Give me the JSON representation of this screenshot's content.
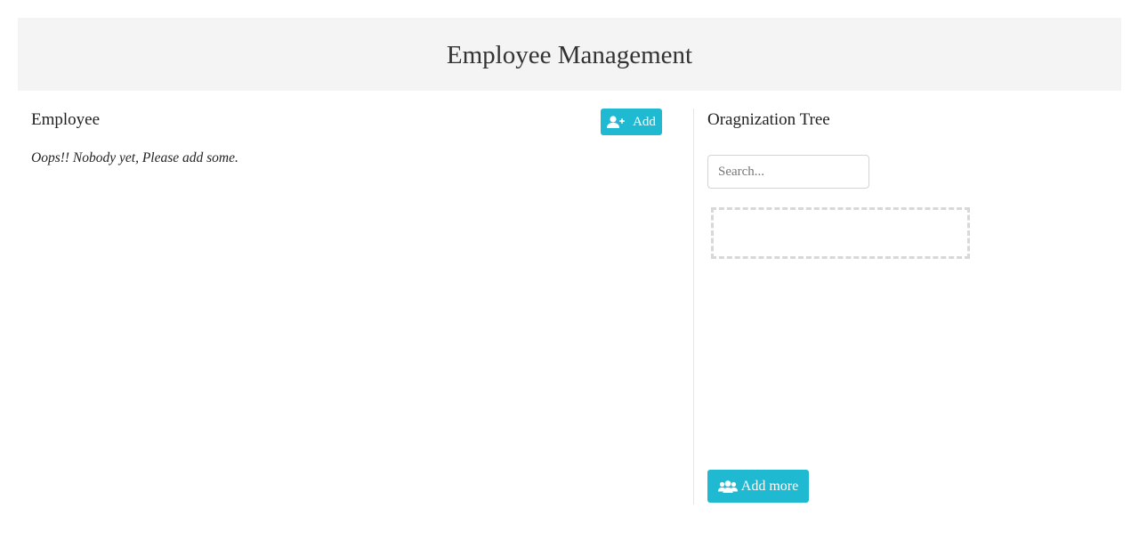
{
  "header": {
    "title": "Employee Management"
  },
  "employee_panel": {
    "title": "Employee",
    "add_button_label": "Add",
    "add_button_icon": "user-plus-icon",
    "empty_message": "Oops!! Nobody yet, Please add some."
  },
  "org_panel": {
    "title": "Oragnization Tree",
    "search_placeholder": "Search...",
    "add_more_label": "Add more",
    "add_more_icon": "users-icon"
  },
  "colors": {
    "accent": "#1fb9d1",
    "header_bg": "#f4f4f4",
    "dashed_border": "#d8d8d8"
  }
}
